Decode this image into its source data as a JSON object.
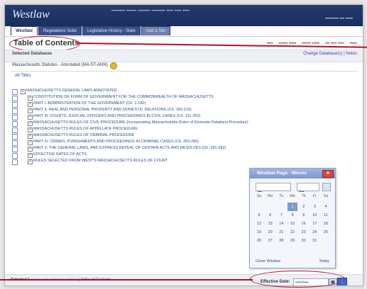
{
  "app": {
    "logo": "Westlaw"
  },
  "topnav": {
    "items": [
      "•••••••• •••••• ••••••• •••••••• •••• •••• ••••"
    ],
    "right": [
      "••••••••• ••• •••••"
    ]
  },
  "tabs": [
    {
      "label": "Westlaw"
    },
    {
      "label": "Regulations Suite"
    },
    {
      "label": "Legislative History - State"
    },
    {
      "label": "Add a Tab"
    }
  ],
  "toc": {
    "title": "Table of Contents"
  },
  "links_right": [
    "••••",
    "•••••• •••••",
    "•••••• •••••",
    "••• •••• ••••",
    "•••••"
  ],
  "selected": {
    "label": "Selected Databases",
    "change": "Change Database(s) | Notes"
  },
  "database": "Massachusetts Statutes - Annotated (MA-ST-ANN)",
  "filter": "All Titles",
  "tree": [
    {
      "level": 0,
      "text": "MASSACHUSETTS GENERAL LAWS ANNOTATED"
    },
    {
      "level": 1,
      "text": "CONSTITUTION OR FORM OF GOVERNMENT FOR THE COMMONWEALTH OF MASSACHUSETTS"
    },
    {
      "level": 1,
      "text": "PART I. ADMINISTRATION OF THE GOVERNMENT (Ch. 1-182)"
    },
    {
      "level": 1,
      "text": "PART II. REAL AND PERSONAL PROPERTY AND DOMESTIC RELATIONS (Ch. 183-210)"
    },
    {
      "level": 1,
      "text": "PART III. COURTS, JUDICIAL OFFICERS AND PROCEEDINGS IN CIVIL CASES (Ch. 211-262)"
    },
    {
      "level": 1,
      "text": "MASSACHUSETTS RULES OF CIVIL PROCEDURE (Incorporating Massachusetts Rules of Domestic Relations Procedure)"
    },
    {
      "level": 1,
      "text": "MASSACHUSETTS RULES OF APPELLATE PROCEDURE"
    },
    {
      "level": 1,
      "text": "MASSACHUSETTS RULES OF CRIMINAL PROCEDURE"
    },
    {
      "level": 1,
      "text": "PART IV. CRIMES, PUNISHMENTS AND PROCEEDINGS IN CRIMINAL CASES (Ch. 263-280)"
    },
    {
      "level": 1,
      "text": "PART V. THE GENERAL LAWS, AND EXPRESS REPEAL OF CERTAIN ACTS AND RESOLVES (Ch. 281-282)"
    },
    {
      "level": 1,
      "text": "EFFECTIVE DATES OF ACTS"
    },
    {
      "level": 1,
      "text": "RULES SELECTED FROM WEST'S MASSACHUSETTS RULES OF COURT"
    }
  ],
  "calendar": {
    "title": "Westlaw Page - Micros",
    "month": "•••",
    "year": "••••",
    "days": [
      "Su",
      "Mo",
      "Tu",
      "We",
      "Th",
      "Fr",
      "Sa"
    ],
    "weeks": [
      [
        "",
        "",
        "",
        "1",
        "2",
        "3",
        "4"
      ],
      [
        "5",
        "6",
        "7",
        "8",
        "9",
        "10",
        "11"
      ],
      [
        "12",
        "13",
        "14",
        "15",
        "16",
        "17",
        "18"
      ],
      [
        "19",
        "20",
        "21",
        "22",
        "23",
        "24",
        "25"
      ],
      [
        "26",
        "27",
        "28",
        "29",
        "30",
        "31",
        ""
      ]
    ],
    "selected_day": "1",
    "footer_left": "Close Window",
    "footer_right": "Today"
  },
  "bottom": {
    "label": "Selected 1",
    "links": "•••• •• ••••• •••••••• •• ••••••••• | Table of Contents",
    "effective_label": "Effective Date:",
    "effective_value": "••/••/••••"
  },
  "colors": {
    "accent": "#b0112e",
    "nav": "#243a6e",
    "link": "#2a4c9a"
  }
}
